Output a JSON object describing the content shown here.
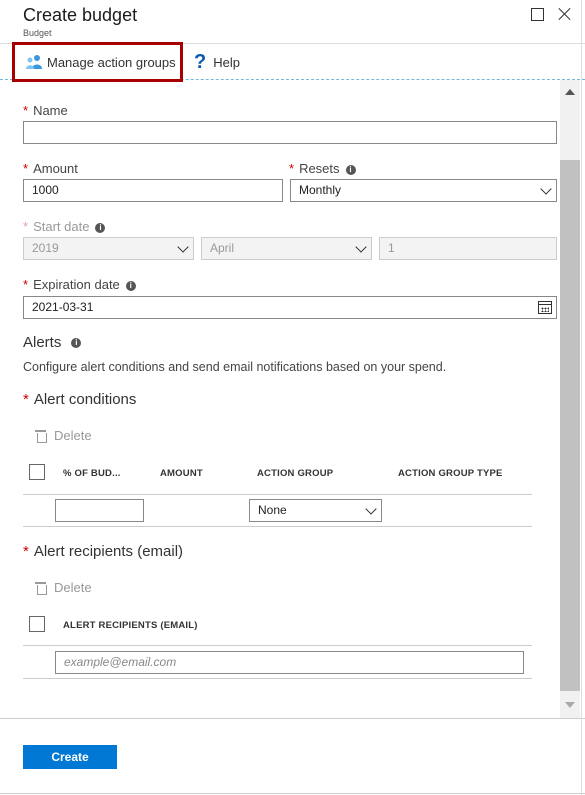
{
  "header": {
    "title": "Create budget",
    "subtitle": "Budget"
  },
  "toolbar": {
    "manage_label": "Manage action groups",
    "help_label": "Help"
  },
  "form": {
    "name_label": "Name",
    "name_value": "",
    "amount_label": "Amount",
    "amount_value": "1000",
    "resets_label": "Resets",
    "resets_value": "Monthly",
    "start_date_label": "Start date",
    "start_year": "2019",
    "start_month": "April",
    "start_day": "1",
    "expiration_label": "Expiration date",
    "expiration_value": "2021-03-31"
  },
  "alerts": {
    "title": "Alerts",
    "description": "Configure alert conditions and send email notifications based on your spend.",
    "conditions_title": "Alert conditions",
    "delete_label": "Delete",
    "columns": [
      "% OF BUD...",
      "AMOUNT",
      "ACTION GROUP",
      "ACTION GROUP TYPE"
    ],
    "action_group_value": "None",
    "recipients_title": "Alert recipients (email)",
    "recipients_delete_label": "Delete",
    "recipients_column": "ALERT RECIPIENTS (EMAIL)",
    "email_placeholder": "example@email.com"
  },
  "footer": {
    "create_label": "Create"
  },
  "colors": {
    "accent": "#0078d4",
    "highlight_border": "#a80000",
    "required": "#cc0000"
  }
}
